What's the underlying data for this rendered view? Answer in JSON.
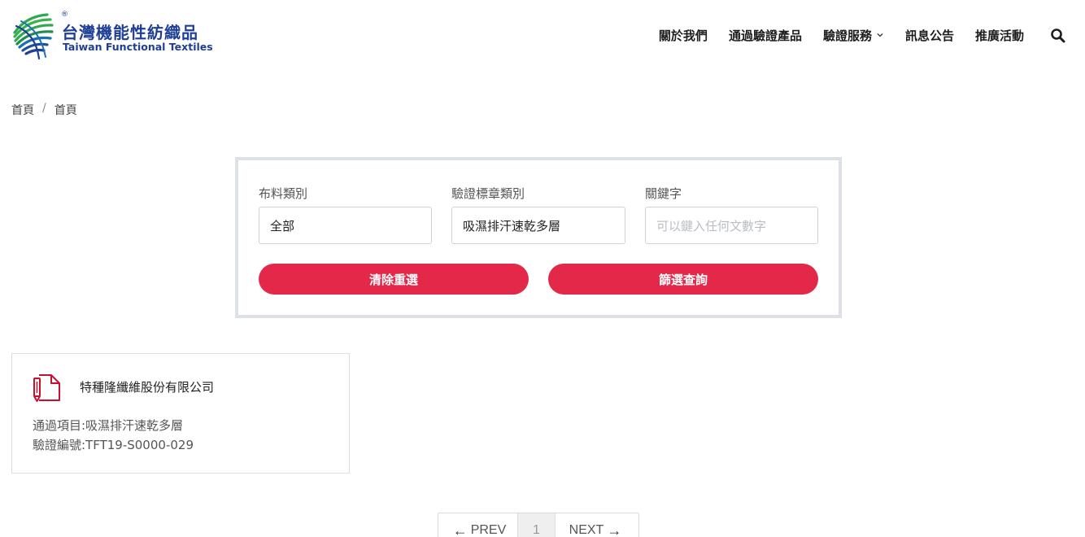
{
  "brand": {
    "name_zh": "台灣機能性紡織品",
    "name_en": "Taiwan Functional Textiles",
    "registered_mark": "®",
    "colors": {
      "blue": "#1f3f95",
      "green": "#2fa84f",
      "accent_red": "#e3284a"
    }
  },
  "nav": {
    "items": [
      {
        "label": "關於我們"
      },
      {
        "label": "通過驗證產品"
      },
      {
        "label": "驗證服務",
        "has_dropdown": true
      },
      {
        "label": "訊息公告"
      },
      {
        "label": "推廣活動"
      }
    ],
    "search_icon": "search-icon"
  },
  "breadcrumb": [
    "首頁",
    "首頁"
  ],
  "breadcrumb_separator": "/",
  "filter": {
    "fabric_label": "布料類別",
    "fabric_value": "全部",
    "cert_label": "驗證標章類別",
    "cert_value": "吸濕排汗速乾多層",
    "keyword_label": "關鍵字",
    "keyword_placeholder": "可以鍵入任何文數字",
    "keyword_value": "",
    "reset_label": "清除重選",
    "search_label": "篩選查詢"
  },
  "results": [
    {
      "company": "特種隆纖維股份有限公司",
      "passed_item": "通過項目:吸濕排汗速乾多層",
      "cert_no": "驗證編號:TFT19-S0000-029",
      "icon": "document-pen-icon"
    }
  ],
  "pagination": {
    "prev_label": "PREV",
    "current_page": "1",
    "next_label": "NEXT"
  }
}
